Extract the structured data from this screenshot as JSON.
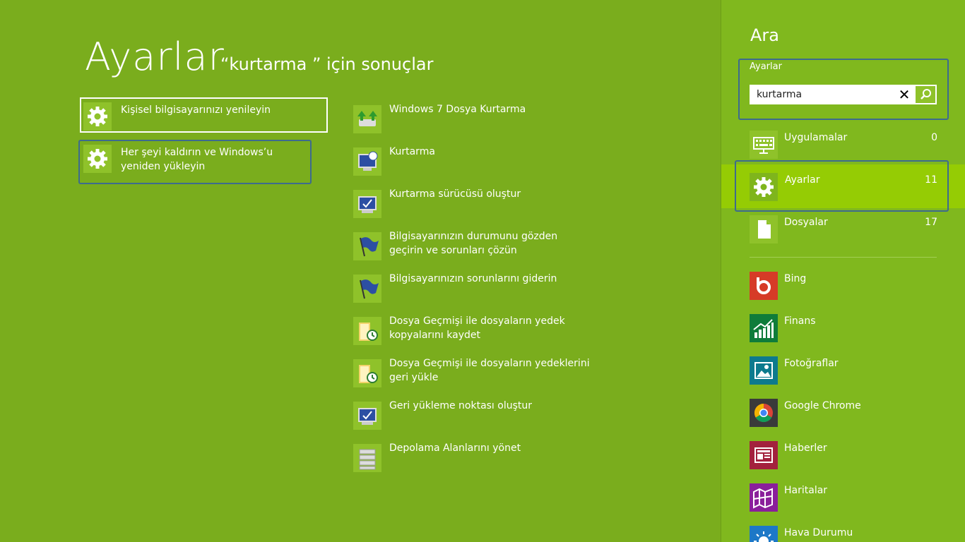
{
  "main": {
    "title": "Ayarlar",
    "subtitle": "“kurtarma ” için sonuçlar",
    "left_items": [
      {
        "label": "Kişisel bilgisayarınızı yenileyin",
        "icon": "gear-icon"
      },
      {
        "label": "Her şeyi kaldırın ve Windows’u yeniden yükleyin",
        "icon": "gear-icon"
      }
    ],
    "results": [
      {
        "label": "Windows 7 Dosya Kurtarma",
        "icon": "backup-icon"
      },
      {
        "label": "Kurtarma",
        "icon": "recovery-icon"
      },
      {
        "label": "Kurtarma sürücüsü oluştur",
        "icon": "recovery-drive-icon"
      },
      {
        "label": "Bilgisayarınızın durumunu gözden geçirin ve sorunları çözün",
        "icon": "flag-icon"
      },
      {
        "label": "Bilgisayarınızın sorunlarını giderin",
        "icon": "flag-icon"
      },
      {
        "label": "Dosya Geçmişi ile dosyaların yedek kopyalarını kaydet",
        "icon": "file-history-icon"
      },
      {
        "label": "Dosya Geçmişi ile dosyaların yedeklerini geri yükle",
        "icon": "file-history-icon"
      },
      {
        "label": "Geri yükleme noktası oluştur",
        "icon": "restore-point-icon"
      },
      {
        "label": "Depolama Alanlarını yönet",
        "icon": "storage-icon"
      }
    ]
  },
  "search_panel": {
    "title": "Ara",
    "scope_label": "Ayarlar",
    "query": "kurtarma",
    "clear_symbol": "✕",
    "categories": [
      {
        "label": "Uygulamalar",
        "count": "0",
        "icon": "keyboard-icon"
      },
      {
        "label": "Ayarlar",
        "count": "11",
        "icon": "gear-icon"
      },
      {
        "label": "Dosyalar",
        "count": "17",
        "icon": "document-icon"
      }
    ],
    "apps": [
      {
        "label": "Bing",
        "icon": "bing-icon",
        "color": "#d63b27"
      },
      {
        "label": "Finans",
        "icon": "finance-icon",
        "color": "#0f7c3a"
      },
      {
        "label": "Fotoğraflar",
        "icon": "photos-icon",
        "color": "#0d7a8d"
      },
      {
        "label": "Google Chrome",
        "icon": "chrome-icon",
        "color": "#3a3a3a"
      },
      {
        "label": "Haberler",
        "icon": "news-icon",
        "color": "#a3213d"
      },
      {
        "label": "Haritalar",
        "icon": "maps-icon",
        "color": "#8a1f9b"
      },
      {
        "label": "Hava Durumu",
        "icon": "weather-icon",
        "color": "#1d78c7"
      }
    ]
  },
  "colors": {
    "background": "#7aad1d",
    "panel": "#80b81e",
    "tile": "#8fc22a",
    "selected_category": "#95cc04",
    "highlight_border": "#3d6b8e"
  }
}
